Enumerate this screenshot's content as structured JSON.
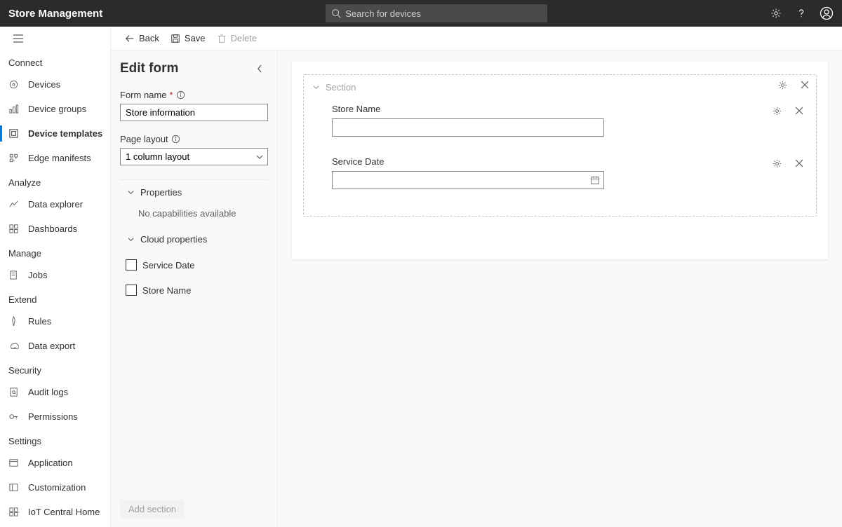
{
  "header": {
    "app_title": "Store Management",
    "search_placeholder": "Search for devices"
  },
  "cmdbar": {
    "back": "Back",
    "save": "Save",
    "delete": "Delete"
  },
  "nav": {
    "sections": [
      {
        "label": "Connect",
        "items": [
          "Devices",
          "Device groups",
          "Device templates",
          "Edge manifests"
        ],
        "active_index": 2
      },
      {
        "label": "Analyze",
        "items": [
          "Data explorer",
          "Dashboards"
        ]
      },
      {
        "label": "Manage",
        "items": [
          "Jobs"
        ]
      },
      {
        "label": "Extend",
        "items": [
          "Rules",
          "Data export"
        ]
      },
      {
        "label": "Security",
        "items": [
          "Audit logs",
          "Permissions"
        ]
      },
      {
        "label": "Settings",
        "items": [
          "Application",
          "Customization",
          "IoT Central Home"
        ]
      }
    ]
  },
  "sidepanel": {
    "title": "Edit form",
    "form_name_label": "Form name",
    "form_name_value": "Store information",
    "page_layout_label": "Page layout",
    "page_layout_value": "1 column layout",
    "properties_label": "Properties",
    "no_capabilities_msg": "No capabilities available",
    "cloud_properties_label": "Cloud properties",
    "cloud_props": [
      {
        "label": "Service Date",
        "checked": false
      },
      {
        "label": "Store Name",
        "checked": false
      }
    ],
    "add_section_label": "Add section"
  },
  "form": {
    "section_label": "Section",
    "fields": [
      {
        "label": "Store Name",
        "kind": "text"
      },
      {
        "label": "Service Date",
        "kind": "date"
      }
    ]
  }
}
